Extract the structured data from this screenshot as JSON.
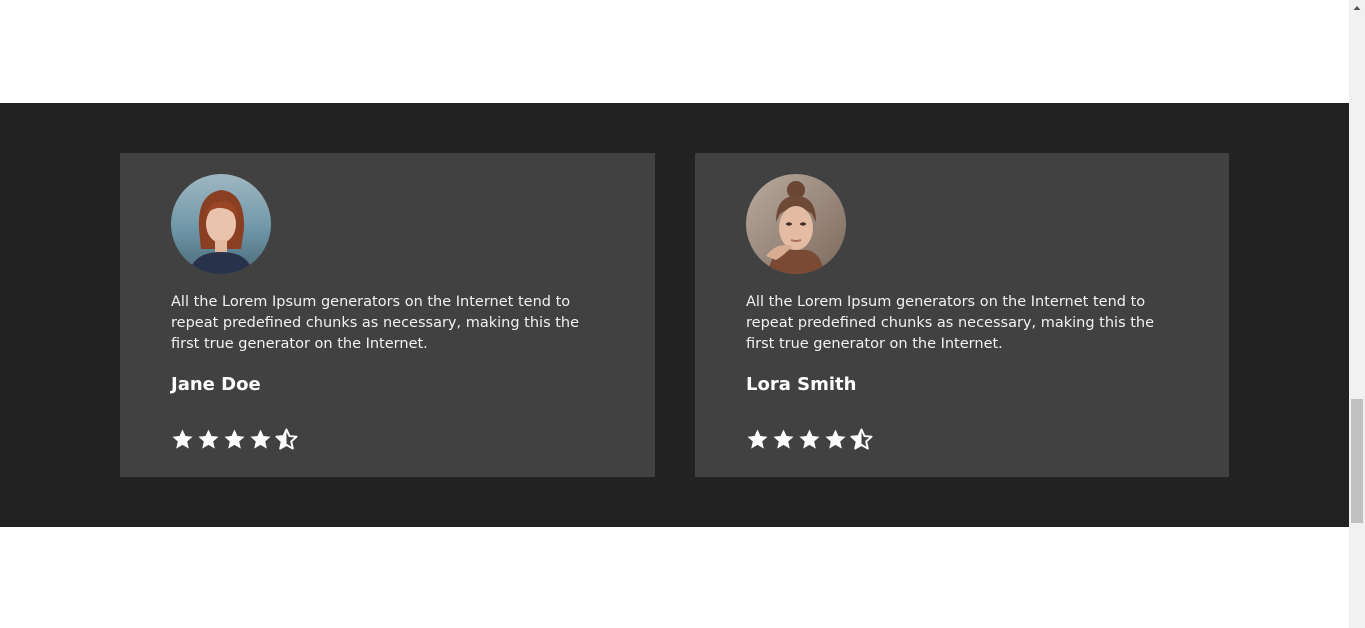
{
  "testimonials": [
    {
      "quote": "All the Lorem Ipsum generators on the Internet tend to repeat predefined chunks as necessary, making this the first true generator on the Internet.",
      "name": "Jane Doe",
      "rating": 4.5,
      "avatar_icon": "avatar-photo"
    },
    {
      "quote": "All the Lorem Ipsum generators on the Internet tend to repeat predefined chunks as necessary, making this the first true generator on the Internet.",
      "name": "Lora Smith",
      "rating": 4.5,
      "avatar_icon": "avatar-photo"
    }
  ],
  "colors": {
    "section_bg": "#222222",
    "card_bg": "#414141",
    "text": "#ffffff"
  }
}
